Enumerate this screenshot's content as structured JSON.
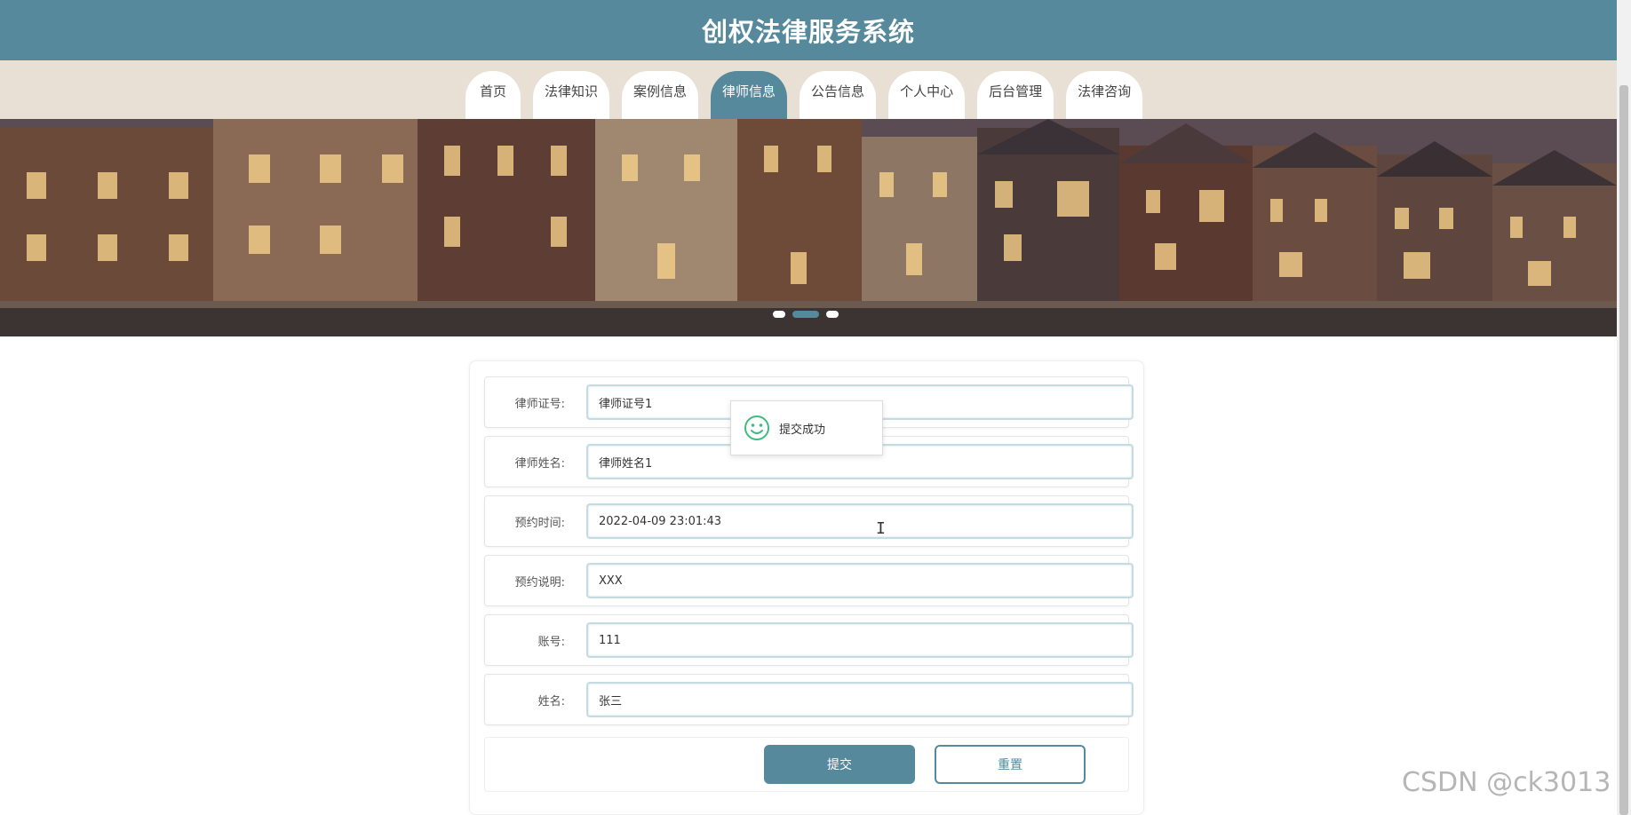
{
  "header": {
    "title": "创权法律服务系统"
  },
  "nav": {
    "items": [
      {
        "label": "首页",
        "active": false
      },
      {
        "label": "法律知识",
        "active": false
      },
      {
        "label": "案例信息",
        "active": false
      },
      {
        "label": "律师信息",
        "active": true
      },
      {
        "label": "公告信息",
        "active": false
      },
      {
        "label": "个人中心",
        "active": false
      },
      {
        "label": "后台管理",
        "active": false
      },
      {
        "label": "法律咨询",
        "active": false
      }
    ]
  },
  "banner": {
    "slide_count": 3,
    "active_slide": 2
  },
  "form": {
    "fields": [
      {
        "label": "律师证号:",
        "value": "律师证号1"
      },
      {
        "label": "律师姓名:",
        "value": "律师姓名1"
      },
      {
        "label": "预约时间:",
        "value": "2022-04-09 23:01:43"
      },
      {
        "label": "预约说明:",
        "value": "XXX"
      },
      {
        "label": "账号:",
        "value": "111"
      },
      {
        "label": "姓名:",
        "value": "张三"
      }
    ],
    "submit_label": "提交",
    "reset_label": "重置"
  },
  "toast": {
    "message": "提交成功",
    "icon": "smile-icon"
  },
  "watermark": "CSDN @ck3013",
  "colors": {
    "primary": "#55899b",
    "nav_bg": "#e8e0d5",
    "toast_icon": "#3dbd7d"
  }
}
